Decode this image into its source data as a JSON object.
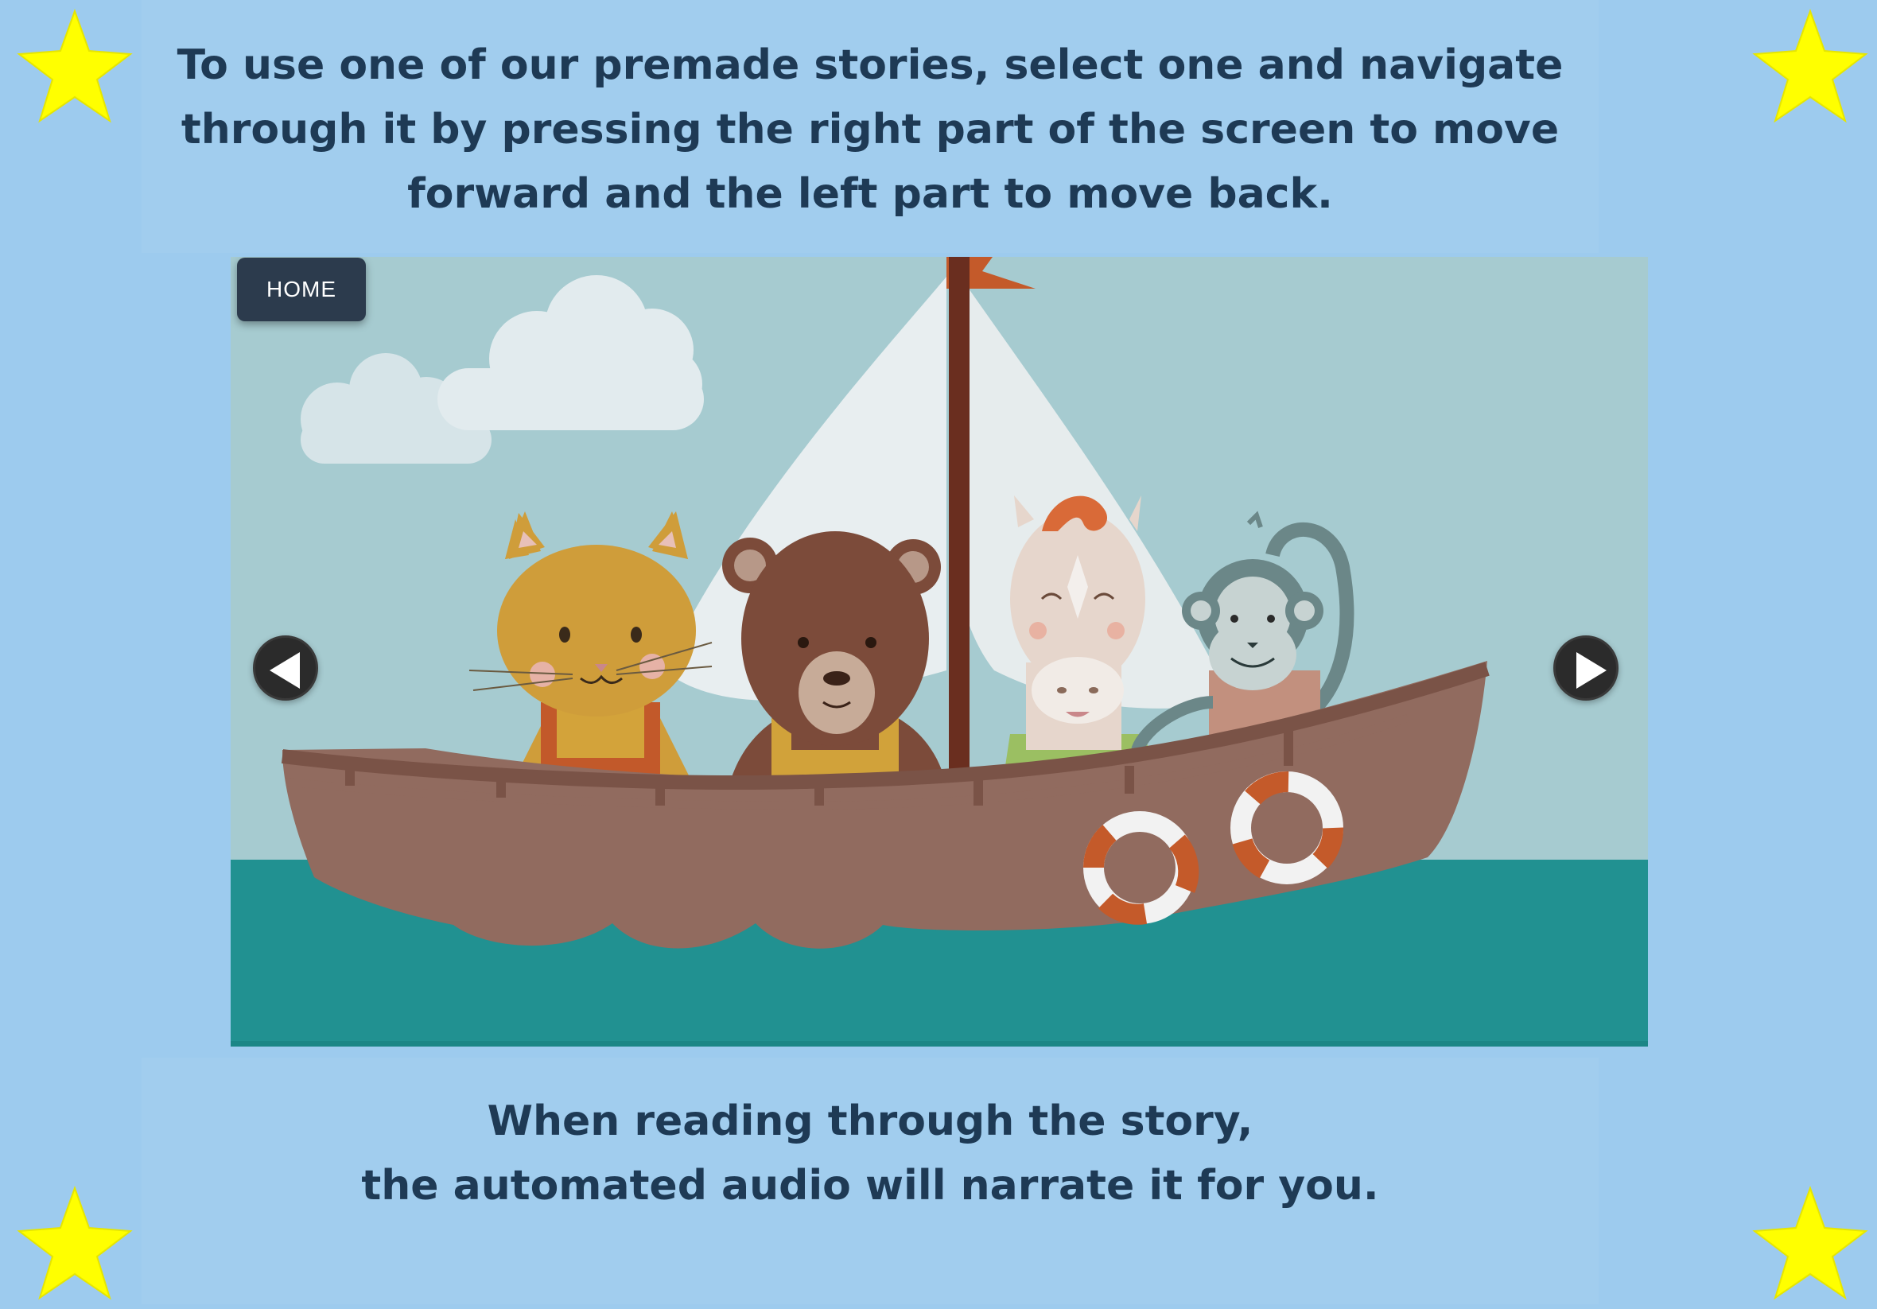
{
  "instructions": {
    "top": "To use one of our premade stories, select one and navigate\nthrough it by pressing the right part of the screen to move\nforward and the left part to move back.",
    "bottom": "When reading through the story,\nthe automated audio will narrate it for you."
  },
  "story_viewer": {
    "home_label": "HOME",
    "prev_icon": "left-triangle-arrow",
    "next_icon": "right-triangle-arrow",
    "scene": "animals-in-sailboat"
  },
  "colors": {
    "background": "#9dcbee",
    "text": "#1e3a55",
    "star": "#ffff00",
    "home_button": "#2c3b4d",
    "nav_button": "#2b2b2b"
  },
  "decorations": {
    "corner_icon": "star-icon"
  }
}
